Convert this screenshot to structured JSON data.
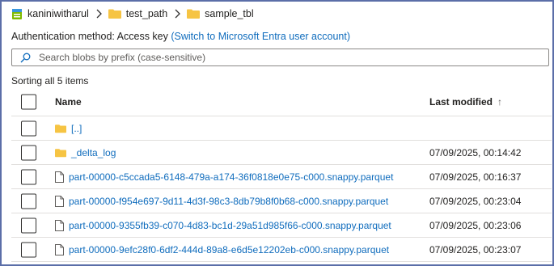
{
  "breadcrumb": {
    "account": "kaniniwitharul",
    "folder1": "test_path",
    "folder2": "sample_tbl"
  },
  "auth": {
    "label": "Authentication method:",
    "value": "Access key",
    "switch_link": "(Switch to Microsoft Entra user account)"
  },
  "search": {
    "placeholder": "Search blobs by prefix (case-sensitive)"
  },
  "sorting_text": "Sorting all 5 items",
  "table": {
    "headers": {
      "name": "Name",
      "last_modified": "Last modified",
      "sort_indicator": "↑"
    },
    "rows": [
      {
        "name": "[..]",
        "type": "folder",
        "modified": ""
      },
      {
        "name": "_delta_log",
        "type": "folder",
        "modified": "07/09/2025, 00:14:42"
      },
      {
        "name": "part-00000-c5ccada5-6148-479a-a174-36f0818e0e75-c000.snappy.parquet",
        "type": "file",
        "modified": "07/09/2025, 00:16:37"
      },
      {
        "name": "part-00000-f954e697-9d11-4d3f-98c3-8db79b8f0b68-c000.snappy.parquet",
        "type": "file",
        "modified": "07/09/2025, 00:23:04"
      },
      {
        "name": "part-00000-9355fb39-c070-4d83-bc1d-29a51d985f66-c000.snappy.parquet",
        "type": "file",
        "modified": "07/09/2025, 00:23:06"
      },
      {
        "name": "part-00000-9efc28f0-6df2-444d-89a8-e6d5e12202eb-c000.snappy.parquet",
        "type": "file",
        "modified": "07/09/2025, 00:23:07"
      }
    ]
  },
  "colors": {
    "link": "#0f6cbd",
    "folder": "#f6c443",
    "border": "#5b6ea8"
  }
}
